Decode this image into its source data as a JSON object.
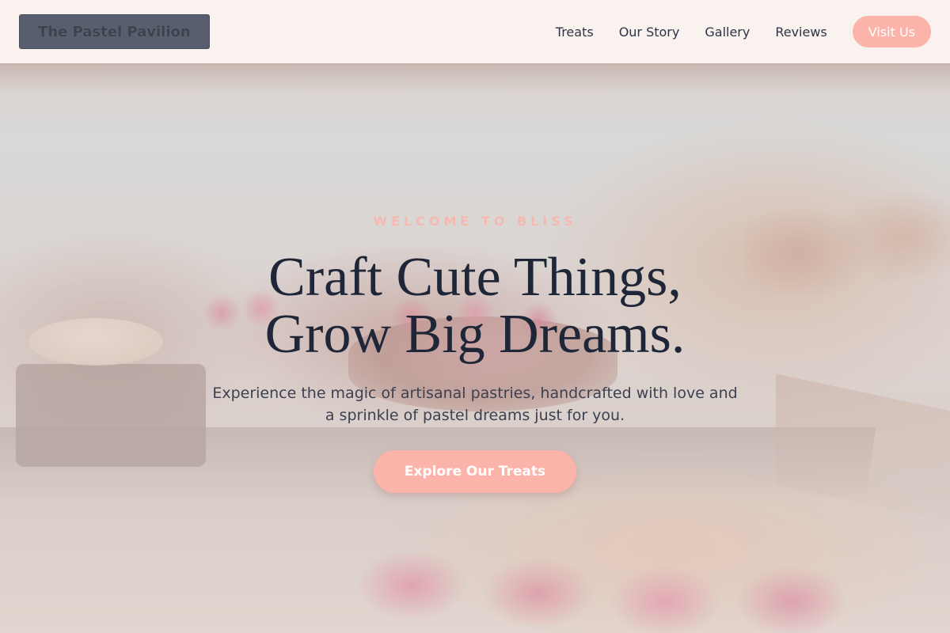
{
  "brand": {
    "logo_text": "The Pastel Pavilion"
  },
  "nav": {
    "links": [
      "Treats",
      "Our Story",
      "Gallery",
      "Reviews"
    ],
    "cta_label": "Visit Us"
  },
  "hero": {
    "eyebrow": "WELCOME TO BLISS",
    "headline_line1": "Craft Cute Things,",
    "headline_line2": "Grow Big Dreams.",
    "subtext": "Experience the magic of artisanal pastries, handcrafted with love and a sprinkle of pastel dreams just for you.",
    "cta_label": "Explore Our Treats"
  },
  "colors": {
    "accent": "#fcb3aa",
    "heading": "#1e2638",
    "logo_bg": "#3c4558"
  }
}
